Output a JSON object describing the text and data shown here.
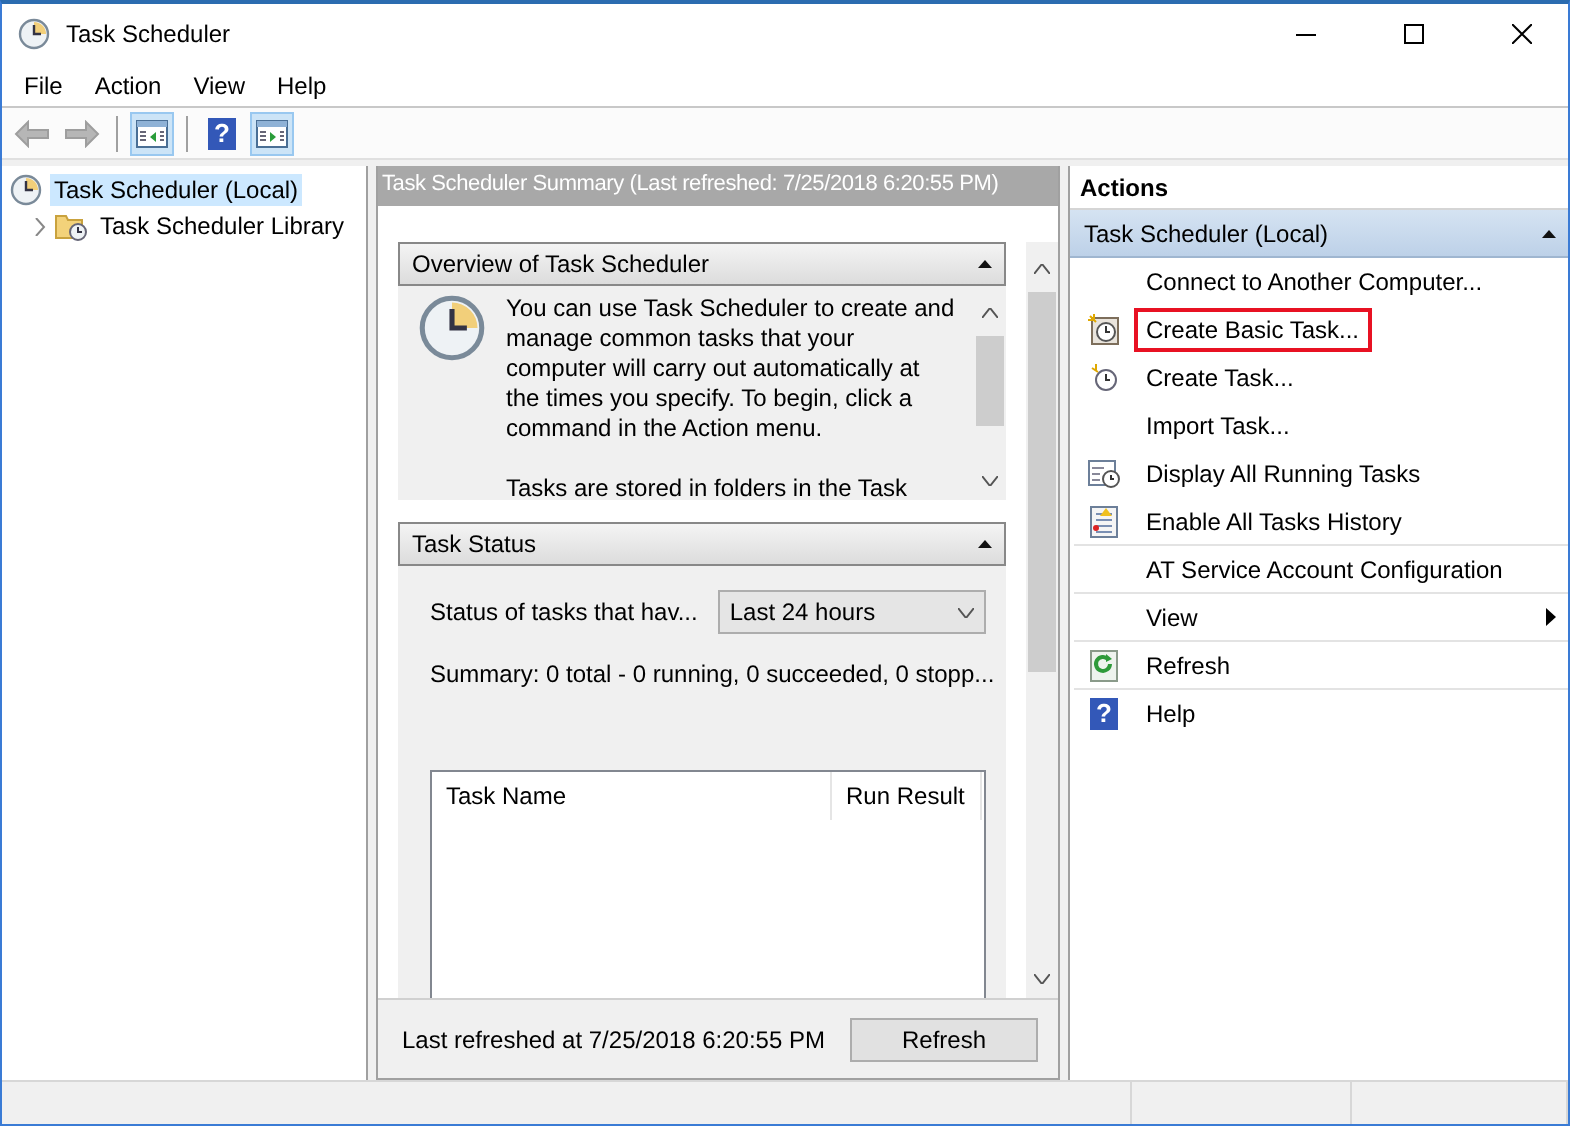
{
  "window": {
    "title": "Task Scheduler"
  },
  "menu": [
    "File",
    "Action",
    "View",
    "Help"
  ],
  "toolbar": [
    {
      "kind": "back",
      "disabled": true
    },
    {
      "kind": "forward",
      "disabled": true
    },
    {
      "kind": "tree",
      "selected": true
    },
    {
      "kind": "help",
      "selected": false,
      "glyph": "?"
    },
    {
      "kind": "actions",
      "selected": true
    }
  ],
  "tree": [
    {
      "label": "Task Scheduler (Local)",
      "selected": true,
      "children": [
        {
          "label": "Task Scheduler Library",
          "selected": false,
          "expanded": false
        }
      ]
    }
  ],
  "summary": {
    "title": "Task Scheduler Summary (Last refreshed: 7/25/2018 6:20:55 PM)",
    "overview": {
      "title": "Overview of Task Scheduler",
      "expanded": true,
      "paragraphs": [
        "You can use Task Scheduler to create and manage common tasks that your computer will carry out automatically at the times you specify. To begin, click a command in the Action menu.",
        "Tasks are stored in folders in the Task"
      ]
    },
    "status": {
      "title": "Task Status",
      "expanded": true,
      "filter_label": "Status of tasks that hav...",
      "filter_value": "Last 24 hours",
      "summary": "Summary: 0 total - 0 running, 0 succeeded, 0 stopp...",
      "columns": [
        "Task Name",
        "Run Result"
      ]
    },
    "last_refreshed": "Last refreshed at 7/25/2018 6:20:55 PM",
    "refresh_button": "Refresh"
  },
  "actions": {
    "title": "Actions",
    "group": "Task Scheduler (Local)",
    "expanded": true,
    "items": [
      {
        "label": "Connect to Another Computer...",
        "kind": "plain",
        "highlighted": false,
        "separated": false
      },
      {
        "label": "Create Basic Task...",
        "kind": "basic",
        "highlighted": true,
        "separated": false
      },
      {
        "label": "Create Task...",
        "kind": "create",
        "highlighted": false,
        "separated": false
      },
      {
        "label": "Import Task...",
        "kind": "plain",
        "highlighted": false,
        "separated": false
      },
      {
        "label": "Display All Running Tasks",
        "kind": "running",
        "highlighted": false,
        "separated": false
      },
      {
        "label": "Enable All Tasks History",
        "kind": "history",
        "highlighted": false,
        "separated": true
      },
      {
        "label": "AT Service Account Configuration",
        "kind": "plain",
        "highlighted": false,
        "separated": true
      },
      {
        "label": "View",
        "kind": "submenu",
        "highlighted": false,
        "separated": true
      },
      {
        "label": "Refresh",
        "kind": "refresh",
        "highlighted": false,
        "separated": true
      },
      {
        "label": "Help",
        "kind": "help",
        "glyph": "?",
        "highlighted": false,
        "separated": false
      }
    ]
  }
}
